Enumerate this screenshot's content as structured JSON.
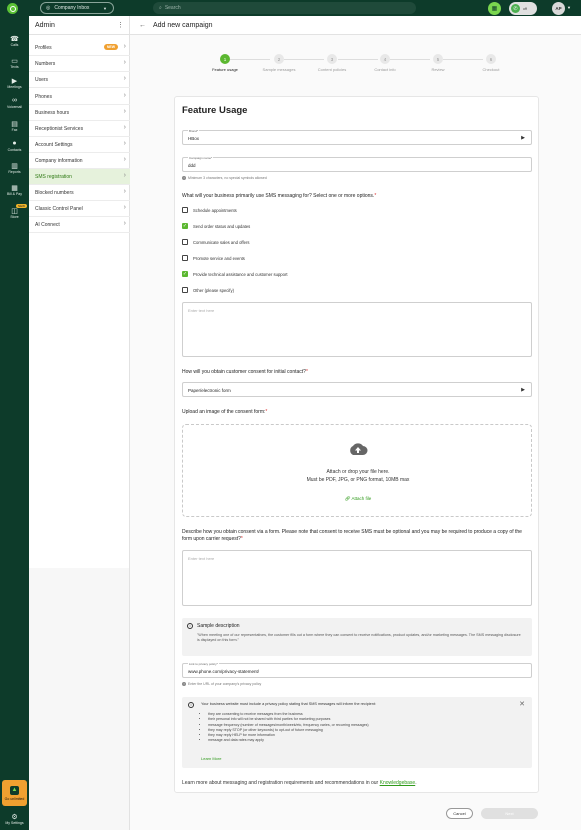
{
  "topbar": {
    "inbox_label": "Company Inbox",
    "search_placeholder": "Search",
    "call_status": "off",
    "avatar_initials": "AP"
  },
  "rail": {
    "items": [
      {
        "label": "Calls",
        "icon": "phone-icon"
      },
      {
        "label": "Texts",
        "icon": "chat-icon"
      },
      {
        "label": "Meetings",
        "icon": "video-icon"
      },
      {
        "label": "Voicemail",
        "icon": "voicemail-icon"
      },
      {
        "label": "Fax",
        "icon": "fax-icon"
      },
      {
        "label": "Contacts",
        "icon": "contacts-icon"
      },
      {
        "label": "Reports",
        "icon": "reports-icon"
      },
      {
        "label": "Bill & Pay",
        "icon": "bill-icon"
      },
      {
        "label": "Store",
        "icon": "store-icon",
        "badge": "NEW"
      }
    ],
    "upgrade_label": "Go unlimited",
    "settings_label": "My Settings"
  },
  "admin": {
    "title": "Admin",
    "items": [
      {
        "label": "Profiles",
        "badge": "NEW"
      },
      {
        "label": "Numbers"
      },
      {
        "label": "Users"
      },
      {
        "label": "Phones"
      },
      {
        "label": "Business hours"
      },
      {
        "label": "Receptionist Services"
      },
      {
        "label": "Account Settings"
      },
      {
        "label": "Company information"
      },
      {
        "label": "SMS registration",
        "active": true
      },
      {
        "label": "Blocked numbers"
      },
      {
        "label": "Classic Control Panel"
      },
      {
        "label": "AI Connect"
      }
    ]
  },
  "main": {
    "title": "Add new campaign",
    "steps": [
      {
        "num": "1",
        "label": "Feature usage",
        "active": true
      },
      {
        "num": "2",
        "label": "Sample messages"
      },
      {
        "num": "3",
        "label": "Content policies"
      },
      {
        "num": "4",
        "label": "Contact info"
      },
      {
        "num": "5",
        "label": "Review"
      },
      {
        "num": "6",
        "label": "Checkout"
      }
    ],
    "card_title": "Feature Usage",
    "brand_label": "Brand*",
    "brand_value": "HBox",
    "campaign_label": "Campaign name*",
    "campaign_value": "ddd",
    "campaign_hint": "Minimum 3 characters, no special symbols allowed",
    "q1": "What will your business primarily use SMS messaging for? Select one or more options.",
    "options": [
      {
        "label": "Schedule appointments",
        "checked": false
      },
      {
        "label": "Send order status and updates",
        "checked": true
      },
      {
        "label": "Communicate sales and offers",
        "checked": false
      },
      {
        "label": "Promote service and events",
        "checked": false
      },
      {
        "label": "Provide technical assistance and customer support",
        "checked": true
      },
      {
        "label": "Other (please specify)",
        "checked": false
      }
    ],
    "other_placeholder": "Enter text here",
    "q2": "How will you obtain customer consent for initial contact?",
    "consent_value": "Paper/electronic form",
    "q3": "Upload an image of the consent form:",
    "drop_line1": "Attach or drop your file here.",
    "drop_line2": "Must be PDF, JPG, or PNG format, 10MB max",
    "attach_label": "Attach file",
    "q4": "Describe how you obtain consent via a form. Please note that consent to receive SMS must be optional and you may be required to produce a copy of the form upon carrier request?",
    "describe_placeholder": "Enter text here",
    "sample_title": "Sample description",
    "sample_body": "\"When meeting one of our representatives, the customer fills out a form where they can consent to receive notifications, product updates, and/or marketing messages. The SMS messaging disclosure is displayed on this form.\"",
    "privacy_label": "Link to privacy policy*",
    "privacy_value": "www.phone.com/privacy-statement/",
    "privacy_hint": "Enter the URL of your company's privacy policy",
    "policy_title": "Your business website must include a privacy policy stating that SMS messages will inform the recipient:",
    "policy_items": [
      "they are consenting to receive messages from the business",
      "their personal info will not be shared with third parties for marketing purposes",
      "message frequency (number of messages/month/week/etc, frequency varies, or recurring messages)",
      "they may reply STOP (or other keywords) to opt-out of future messaging",
      "they may reply HELP for more information",
      "message and data rates may apply"
    ],
    "learn_more": "Learn More",
    "footer_text": "Learn more about messaging and registration requirements and recommendations in our",
    "footer_link": "Knowledgebase",
    "footer_end": ".",
    "cancel_label": "Cancel",
    "next_label": "Next"
  },
  "colors": {
    "brand_dark": "#0d3b2a",
    "accent_green": "#5bb730",
    "upgrade_orange": "#f0a030"
  }
}
